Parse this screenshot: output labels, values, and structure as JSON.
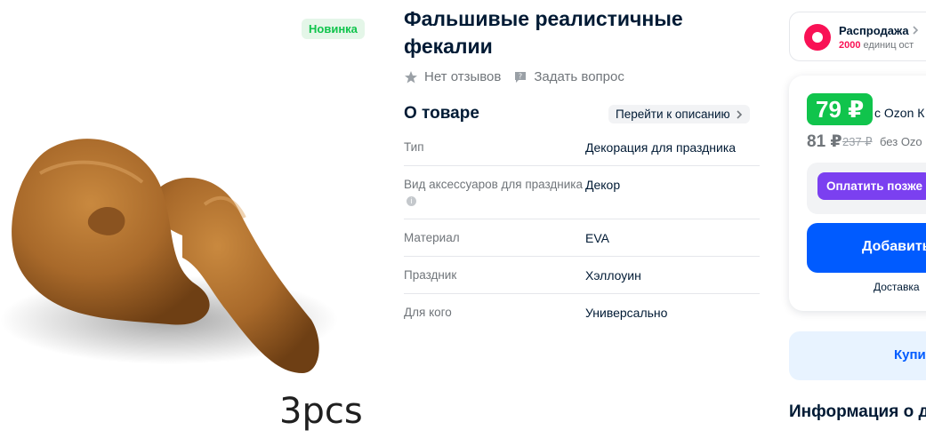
{
  "product": {
    "badge": "Новинка",
    "image_caption": "3pcs",
    "title_line1": "Фальшивые реалистичные",
    "title_line2": "фекалии",
    "reviews": "Нет отзывов",
    "ask_question": "Задать вопрос"
  },
  "about": {
    "title": "О товаре",
    "link": "Перейти к описанию",
    "specs": [
      {
        "key": "Тип",
        "value": "Декорация для праздника"
      },
      {
        "key": "Вид аксессуаров для праздника",
        "value": "Декор"
      },
      {
        "key": "Материал",
        "value": "EVA"
      },
      {
        "key": "Праздник",
        "value": "Хэллоуин"
      },
      {
        "key": "Для кого",
        "value": "Универсально"
      }
    ]
  },
  "sale": {
    "title": "Распродажа",
    "count": "2000",
    "sub": "единиц ост"
  },
  "price": {
    "ozon_price": "79 ₽",
    "ozon_label": "с Ozon К",
    "regular_price": "81 ₽",
    "old_price": "237 ₽",
    "regular_label": "без Ozo",
    "split_button": "Оплатить позже",
    "add_button": "Добавить",
    "delivery": "Доставка"
  },
  "buy_card": {
    "label": "Купи"
  },
  "store_info": "Информация о д",
  "colors": {
    "accent_blue": "#005bff",
    "ozon_green": "#10c44c",
    "sale_pink": "#f91155",
    "split_purple": "#7b40f0"
  },
  "icons": [
    "star-icon",
    "question-icon",
    "chevron-right-icon",
    "info-icon",
    "chevron-right-icon"
  ]
}
